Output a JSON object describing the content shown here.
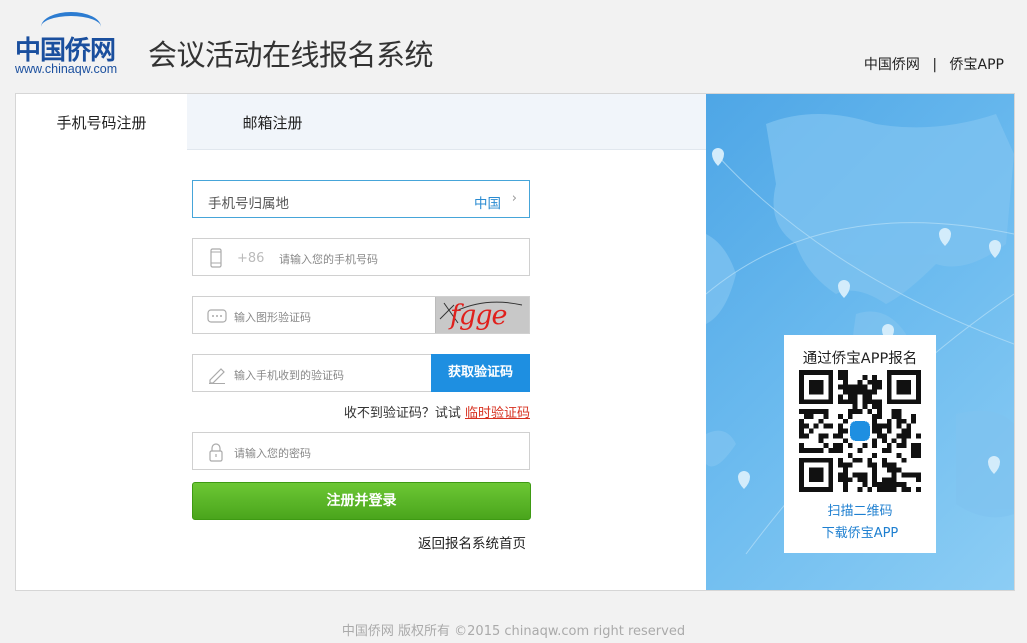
{
  "header": {
    "logo_cn": "中国侨网",
    "logo_url": "www.chinaqw.com",
    "system_title": "会议活动在线报名系统",
    "links": [
      "中国侨网",
      "侨宝APP"
    ],
    "separator": "|"
  },
  "tabs": [
    {
      "label": "手机号码注册",
      "active": true
    },
    {
      "label": "邮箱注册",
      "active": false
    }
  ],
  "form": {
    "location_label": "手机号归属地",
    "location_value": "中国",
    "phone_prefix": "+86",
    "phone_placeholder": "请输入您的手机号码",
    "captcha_placeholder": "输入图形验证码",
    "captcha_code": "fgge",
    "sms_placeholder": "输入手机收到的验证码",
    "sms_button": "获取验证码",
    "hint_text": "收不到验证码？试试 ",
    "hint_link": "临时验证码",
    "password_placeholder": "请输入您的密码",
    "submit": "注册并登录",
    "back_home": "返回报名系统首页"
  },
  "qr_panel": {
    "title": "通过侨宝APP报名",
    "scan": "扫描二维码",
    "download": "下载侨宝APP"
  },
  "footer": "中国侨网 版权所有 ©2015 chinaqw.com right reserved",
  "colors": {
    "accent_blue": "#1e8fe1",
    "link_red": "#d7301f",
    "submit_green": "#4aa51c",
    "map_blue": "#4ea6e6"
  }
}
